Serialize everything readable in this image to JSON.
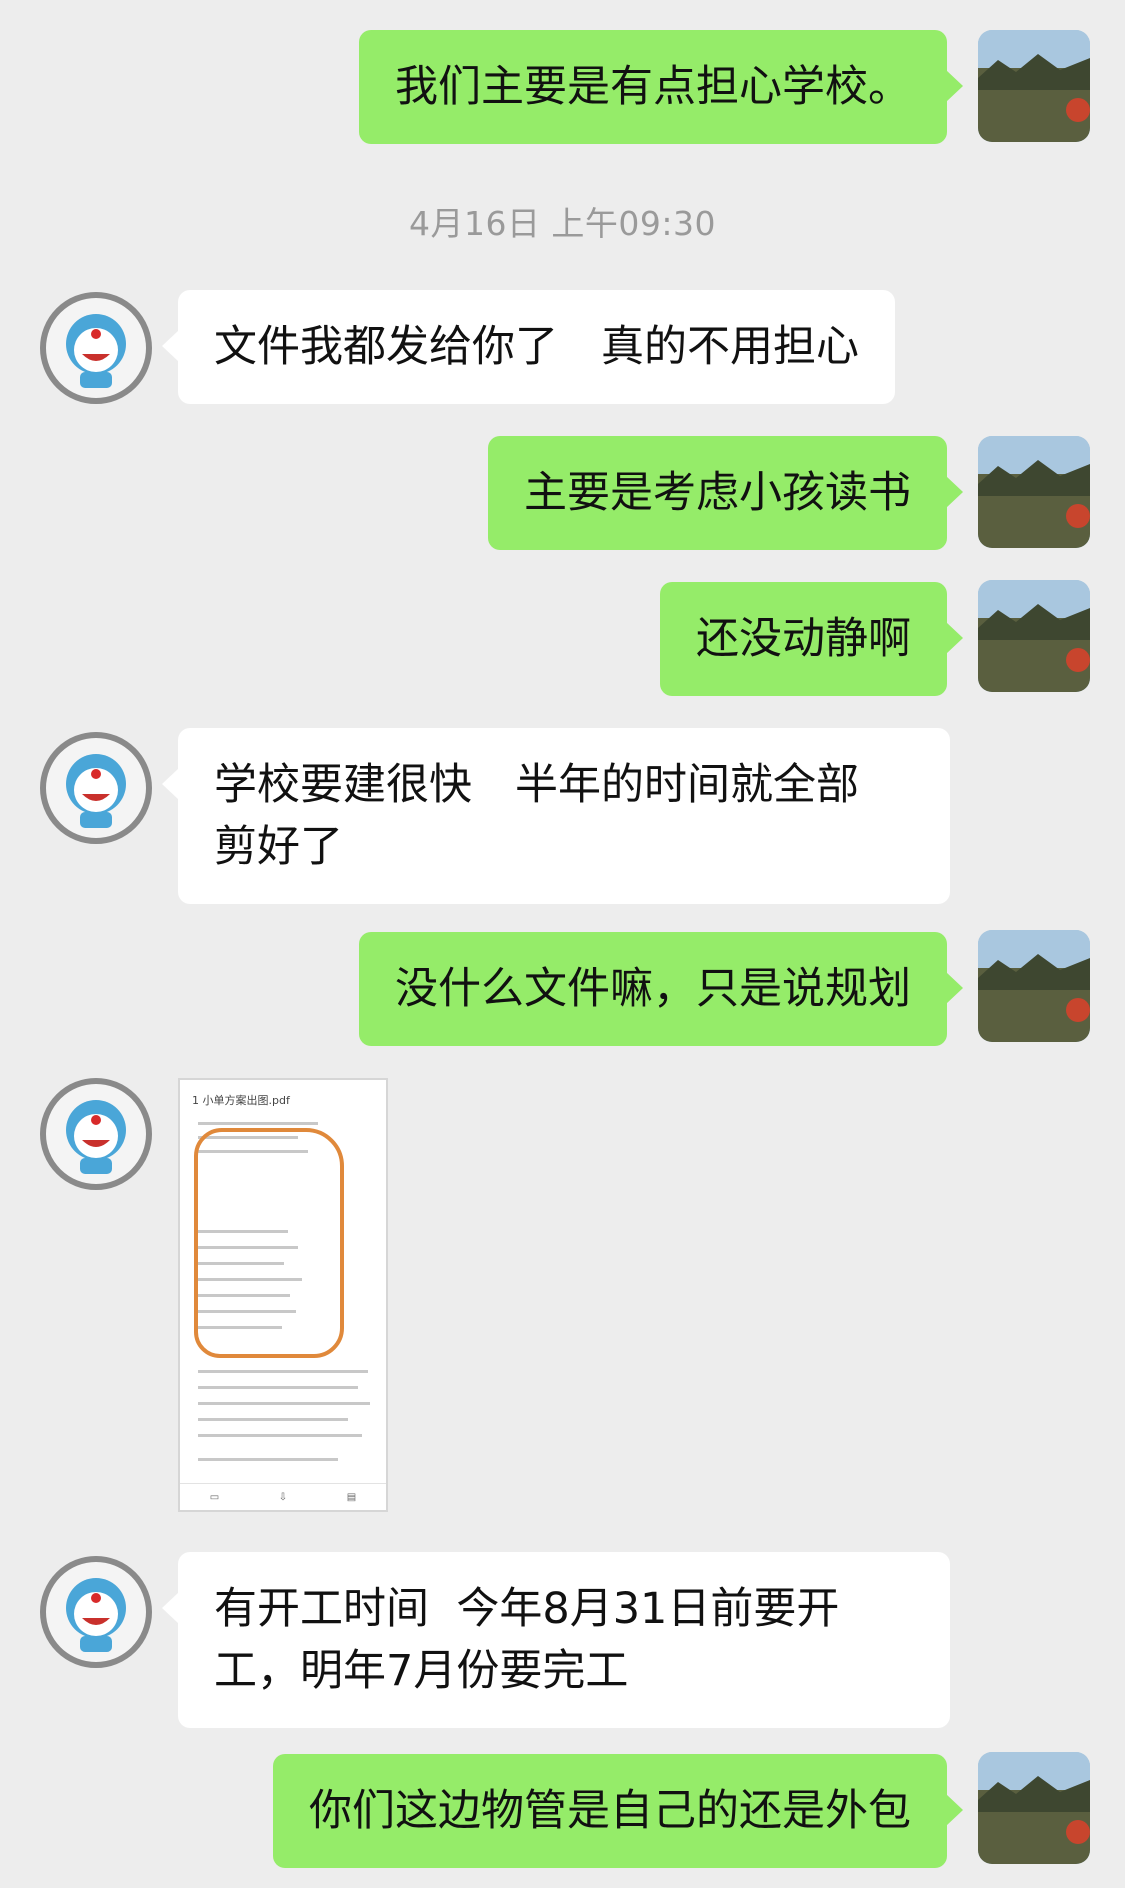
{
  "messages": {
    "m1": "我们主要是有点担心学校。",
    "m2": "文件我都发给你了　真的不用担心",
    "m3": "主要是考虑小孩读书",
    "m4": "还没动静啊",
    "m5": "学校要建很快　半年的时间就全部\n剪好了",
    "m6": "没什么文件嘛，只是说规划",
    "m7": "有开工时间  今年8月31日前要开\n工，明年7月份要完工",
    "m8": "你们这边物管是自己的还是外包"
  },
  "timestamp": "4月16日 上午09:30",
  "attachment": {
    "filename": "1 小单方案出图.pdf"
  },
  "icons": {
    "me_avatar": "landscape-avatar-icon",
    "them_avatar": "cartoon-avatar-icon"
  },
  "colors": {
    "background": "#ededed",
    "my_bubble": "#95ec69",
    "their_bubble": "#ffffff",
    "highlight_circle": "#e0893b"
  }
}
